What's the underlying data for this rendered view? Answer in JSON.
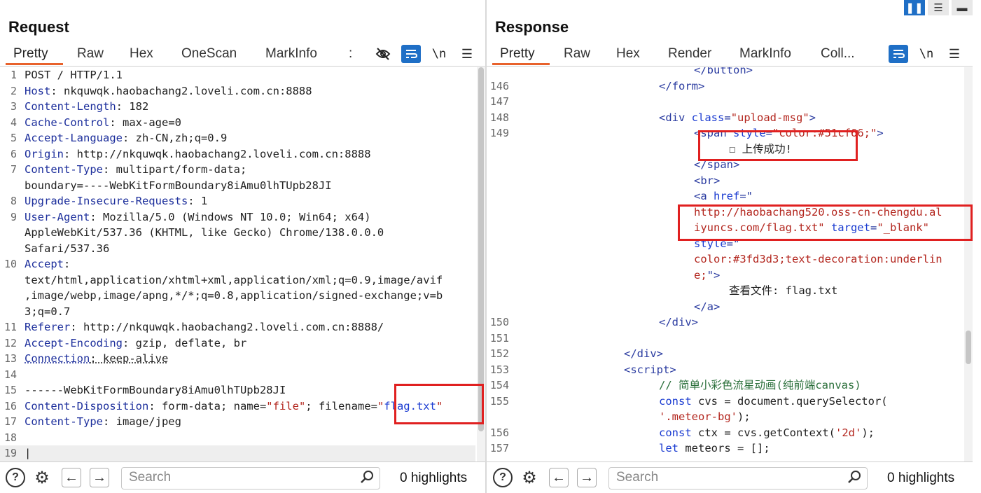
{
  "request": {
    "title": "Request",
    "tabs": [
      "Pretty",
      "Raw",
      "Hex",
      "OneScan",
      "MarkInfo",
      ":"
    ],
    "active_tab": "Pretty",
    "tool_icons": [
      "hide-icon",
      "wrap-icon",
      "newline-icon",
      "menu-icon"
    ],
    "newline_label": "\\n",
    "lines": [
      {
        "n": "1",
        "parts": [
          [
            "v",
            "POST / HTTP/1.1"
          ]
        ]
      },
      {
        "n": "2",
        "parts": [
          [
            "k",
            "Host"
          ],
          [
            "v",
            ": nkquwqk.haobachang2.loveli.com.cn:8888"
          ]
        ]
      },
      {
        "n": "3",
        "parts": [
          [
            "k",
            "Content-Length"
          ],
          [
            "v",
            ": 182"
          ]
        ]
      },
      {
        "n": "4",
        "parts": [
          [
            "k",
            "Cache-Control"
          ],
          [
            "v",
            ": max-age=0"
          ]
        ]
      },
      {
        "n": "5",
        "parts": [
          [
            "k",
            "Accept-Language"
          ],
          [
            "v",
            ": zh-CN,zh;q=0.9"
          ]
        ]
      },
      {
        "n": "6",
        "parts": [
          [
            "k",
            "Origin"
          ],
          [
            "v",
            ": http://nkquwqk.haobachang2.loveli.com.cn:8888"
          ]
        ]
      },
      {
        "n": "7",
        "parts": [
          [
            "k",
            "Content-Type"
          ],
          [
            "v",
            ": multipart/form-data;"
          ]
        ]
      },
      {
        "n": "",
        "parts": [
          [
            "v",
            "boundary=----WebKitFormBoundary8iAmu0lhTUpb28JI"
          ]
        ]
      },
      {
        "n": "8",
        "parts": [
          [
            "k",
            "Upgrade-Insecure-Requests"
          ],
          [
            "v",
            ": 1"
          ]
        ]
      },
      {
        "n": "9",
        "parts": [
          [
            "k",
            "User-Agent"
          ],
          [
            "v",
            ": Mozilla/5.0 (Windows NT 10.0; Win64; x64)"
          ]
        ]
      },
      {
        "n": "",
        "parts": [
          [
            "v",
            "AppleWebKit/537.36 (KHTML, like Gecko) Chrome/138.0.0.0"
          ]
        ]
      },
      {
        "n": "",
        "parts": [
          [
            "v",
            "Safari/537.36"
          ]
        ]
      },
      {
        "n": "10",
        "parts": [
          [
            "k",
            "Accept"
          ],
          [
            "v",
            ":"
          ]
        ]
      },
      {
        "n": "",
        "parts": [
          [
            "v",
            "text/html,application/xhtml+xml,application/xml;q=0.9,image/avif"
          ]
        ]
      },
      {
        "n": "",
        "parts": [
          [
            "v",
            ",image/webp,image/apng,*/*;q=0.8,application/signed-exchange;v=b"
          ]
        ]
      },
      {
        "n": "",
        "parts": [
          [
            "v",
            "3;q=0.7"
          ]
        ]
      },
      {
        "n": "11",
        "parts": [
          [
            "k",
            "Referer"
          ],
          [
            "v",
            ": http://nkquwqk.haobachang2.loveli.com.cn:8888/"
          ]
        ]
      },
      {
        "n": "12",
        "parts": [
          [
            "k",
            "Accept-Encoding"
          ],
          [
            "v",
            ": gzip, deflate, br"
          ]
        ]
      },
      {
        "n": "13",
        "parts": [
          [
            "k",
            "Connection"
          ],
          [
            "v",
            ": keep-alive"
          ]
        ]
      },
      {
        "n": "14",
        "parts": []
      },
      {
        "n": "15",
        "parts": [
          [
            "v",
            "------WebKitFormBoundary8iAmu0lhTUpb28JI"
          ]
        ]
      },
      {
        "n": "16",
        "parts": [
          [
            "k",
            "Content-Disposition"
          ],
          [
            "v",
            ": form-data; name="
          ],
          [
            "s",
            "\"file\""
          ],
          [
            "v",
            "; filename="
          ],
          [
            "s",
            "\""
          ],
          [
            "blue",
            "flag.txt"
          ],
          [
            "s",
            "\""
          ]
        ]
      },
      {
        "n": "17",
        "parts": [
          [
            "k",
            "Content-Type"
          ],
          [
            "v",
            ": image/jpeg"
          ]
        ]
      },
      {
        "n": "18",
        "parts": []
      },
      {
        "n": "19",
        "parts": [
          [
            "v",
            "|"
          ]
        ]
      }
    ],
    "bottom": {
      "search_placeholder": "Search",
      "highlights": "0 highlights"
    }
  },
  "response": {
    "title": "Response",
    "tabs": [
      "Pretty",
      "Raw",
      "Hex",
      "Render",
      "MarkInfo",
      "Coll..."
    ],
    "active_tab": "Pretty",
    "tool_icons": [
      "wrap-icon",
      "newline-icon",
      "menu-icon"
    ],
    "newline_label": "\\n",
    "layout_buttons": [
      "split-horizontal-icon",
      "split-vertical-icon",
      "single-pane-icon"
    ],
    "lines": [
      {
        "n": "",
        "indent": 20,
        "parts": [
          [
            "tag",
            "</button>"
          ]
        ]
      },
      {
        "n": "146",
        "indent": 16,
        "parts": [
          [
            "tag",
            "</form>"
          ]
        ]
      },
      {
        "n": "147",
        "indent": 0,
        "parts": []
      },
      {
        "n": "148",
        "indent": 16,
        "parts": [
          [
            "tag",
            "<div "
          ],
          [
            "attr",
            "class"
          ],
          [
            "tag",
            "="
          ],
          [
            "str",
            "\"upload-msg\""
          ],
          [
            "tag",
            ">"
          ]
        ]
      },
      {
        "n": "149",
        "indent": 20,
        "parts": [
          [
            "tag",
            "<span "
          ],
          [
            "attr",
            "style"
          ],
          [
            "tag",
            "="
          ],
          [
            "str",
            "\"color:#51cf66;\""
          ],
          [
            "tag",
            ">"
          ]
        ]
      },
      {
        "n": "",
        "indent": 24,
        "parts": [
          [
            "v",
            "☐ 上传成功!"
          ]
        ]
      },
      {
        "n": "",
        "indent": 20,
        "parts": [
          [
            "tag",
            "</span>"
          ]
        ]
      },
      {
        "n": "",
        "indent": 20,
        "parts": [
          [
            "tag",
            "<br>"
          ]
        ]
      },
      {
        "n": "",
        "indent": 20,
        "parts": [
          [
            "tag",
            "<a "
          ],
          [
            "attr",
            "href"
          ],
          [
            "tag",
            "=\""
          ]
        ]
      },
      {
        "n": "",
        "indent": 20,
        "parts": [
          [
            "str",
            "http://haobachang520.oss-cn-chengdu.al"
          ]
        ]
      },
      {
        "n": "",
        "indent": 20,
        "parts": [
          [
            "str",
            "iyuncs.com/flag.txt\" "
          ],
          [
            "attr",
            "target"
          ],
          [
            "tag",
            "="
          ],
          [
            "str",
            "\"_blank\""
          ]
        ]
      },
      {
        "n": "",
        "indent": 20,
        "parts": [
          [
            "attr",
            "style"
          ],
          [
            "tag",
            "=\""
          ]
        ]
      },
      {
        "n": "",
        "indent": 20,
        "parts": [
          [
            "str",
            "color:#3fd3d3;text-decoration:underlin"
          ]
        ]
      },
      {
        "n": "",
        "indent": 20,
        "parts": [
          [
            "str",
            "e;"
          ],
          [
            "tag",
            "\">"
          ]
        ]
      },
      {
        "n": "",
        "indent": 24,
        "parts": [
          [
            "v",
            "查看文件: flag.txt"
          ]
        ]
      },
      {
        "n": "",
        "indent": 20,
        "parts": [
          [
            "tag",
            "</a>"
          ]
        ]
      },
      {
        "n": "150",
        "indent": 16,
        "parts": [
          [
            "tag",
            "</div>"
          ]
        ]
      },
      {
        "n": "151",
        "indent": 0,
        "parts": []
      },
      {
        "n": "152",
        "indent": 12,
        "parts": [
          [
            "tag",
            "</div>"
          ]
        ]
      },
      {
        "n": "153",
        "indent": 12,
        "parts": [
          [
            "tag",
            "<script>"
          ]
        ]
      },
      {
        "n": "154",
        "indent": 16,
        "parts": [
          [
            "cm",
            "// 简单小彩色流星动画(纯前端canvas)"
          ]
        ]
      },
      {
        "n": "155",
        "indent": 16,
        "parts": [
          [
            "kw",
            "const"
          ],
          [
            "v",
            " cvs = document.querySelector("
          ]
        ]
      },
      {
        "n": "",
        "indent": 16,
        "parts": [
          [
            "str",
            "'.meteor-bg'"
          ],
          [
            "v",
            ");"
          ]
        ]
      },
      {
        "n": "156",
        "indent": 16,
        "parts": [
          [
            "kw",
            "const"
          ],
          [
            "v",
            " ctx = cvs.getContext("
          ],
          [
            "str",
            "'2d'"
          ],
          [
            "v",
            ");"
          ]
        ]
      },
      {
        "n": "157",
        "indent": 16,
        "parts": [
          [
            "kw",
            "let"
          ],
          [
            "v",
            " meteors = [];"
          ]
        ]
      }
    ],
    "bottom": {
      "search_placeholder": "Search",
      "highlights": "0 highlights"
    }
  }
}
